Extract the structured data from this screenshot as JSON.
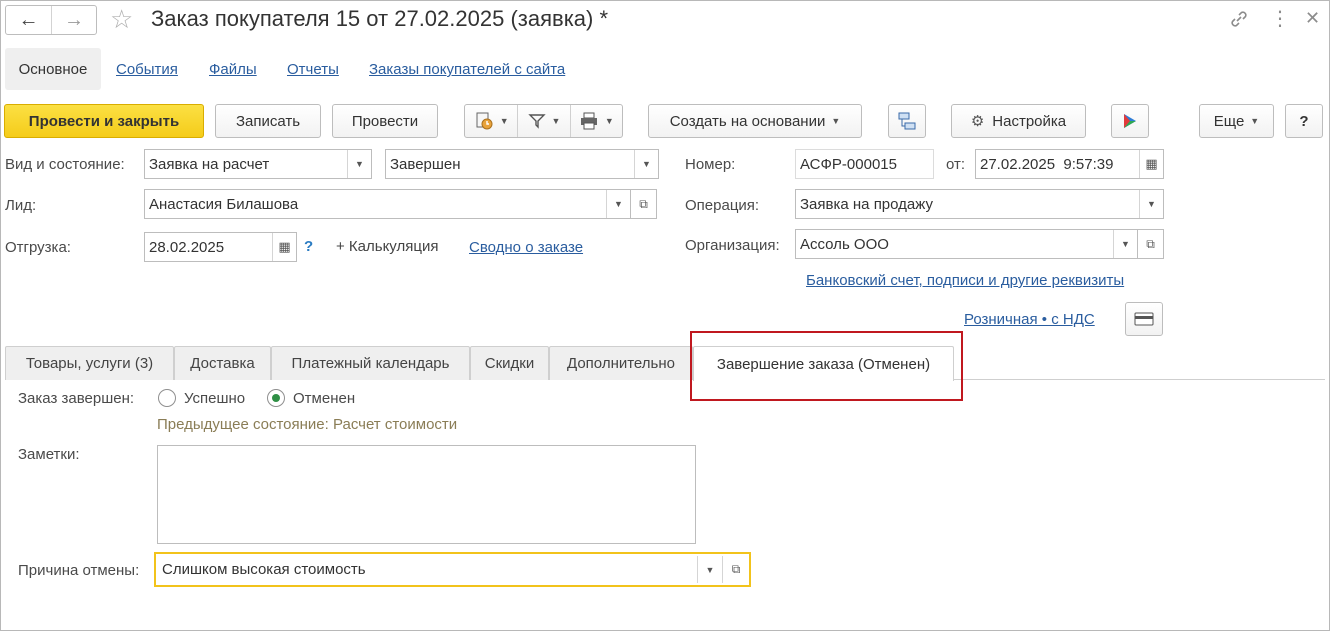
{
  "window": {
    "title": "Заказ покупателя 15 от 27.02.2025 (заявка) *",
    "icons": [
      "link-icon",
      "more-vertical-icon",
      "close-icon"
    ]
  },
  "sections": {
    "active": "Основное",
    "links": [
      "События",
      "Файлы",
      "Отчеты",
      "Заказы покупателей с сайта"
    ]
  },
  "toolbar": {
    "post_close": "Провести и закрыть",
    "save": "Записать",
    "post": "Провести",
    "create_based": "Создать на основании",
    "settings": "Настройка",
    "more": "Еще",
    "help": "?"
  },
  "form": {
    "kind_label": "Вид и состояние:",
    "kind_value": "Заявка на расчет",
    "state_value": "Завершен",
    "lead_label": "Лид:",
    "lead_value": "Анастасия Билашова",
    "shipment_label": "Отгрузка:",
    "shipment_value": "28.02.2025",
    "help_mark": "?",
    "calc_link": "+ Калькуляция",
    "summary_link": "Сводно о заказе",
    "number_label": "Номер:",
    "number_value": "АСФР-000015",
    "from_label": "от:",
    "date_value": "27.02.2025  9:57:39",
    "operation_label": "Операция:",
    "operation_value": "Заявка на продажу",
    "org_label": "Организация:",
    "org_value": "Ассоль ООО",
    "bank_link": "Банковский счет, подписи и другие реквизиты",
    "price_link": "Розничная • с НДС"
  },
  "tabs": [
    {
      "label": "Товары, услуги (3)",
      "active": false
    },
    {
      "label": "Доставка",
      "active": false
    },
    {
      "label": "Платежный календарь",
      "active": false
    },
    {
      "label": "Скидки",
      "active": false
    },
    {
      "label": "Дополнительно",
      "active": false
    },
    {
      "label": "Завершение заказа (Отменен)",
      "active": true
    }
  ],
  "completion": {
    "completed_label": "Заказ завершен:",
    "option_success": "Успешно",
    "option_cancelled": "Отменен",
    "selected": "Отменен",
    "previous_state": "Предыдущее состояние: Расчет стоимости",
    "notes_label": "Заметки:",
    "notes_value": "",
    "reason_label": "Причина отмены:",
    "reason_value": "Слишком высокая стоимость"
  },
  "colors": {
    "primary_button": "#f5cc1a",
    "link": "#2a5d9f",
    "highlight_border": "#c0181f",
    "focus_border": "#f2c31b",
    "radio_selected": "#2f8f45"
  }
}
